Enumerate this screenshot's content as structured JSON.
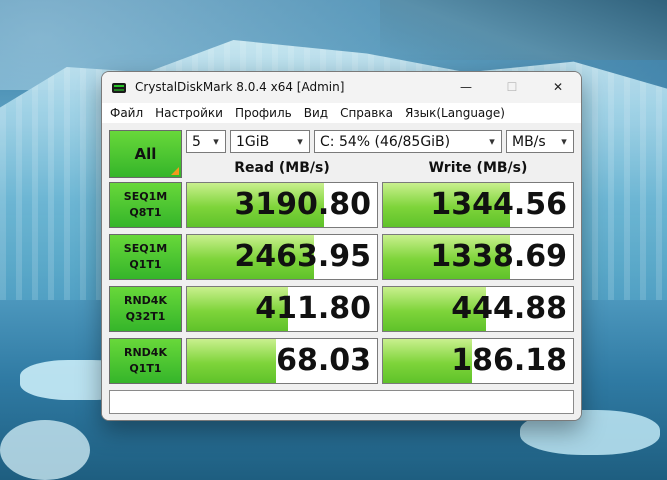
{
  "window": {
    "title": "CrystalDiskMark 8.0.4 x64 [Admin]",
    "controls": {
      "minimize": "—",
      "maximize": "☐",
      "close": "✕"
    }
  },
  "menu": [
    "Файл",
    "Настройки",
    "Профиль",
    "Вид",
    "Справка",
    "Язык(Language)"
  ],
  "controls": {
    "all_label": "All",
    "count": "5",
    "size": "1GiB",
    "drive": "C: 54% (46/85GiB)",
    "unit": "MB/s"
  },
  "columns": {
    "read": "Read (MB/s)",
    "write": "Write (MB/s)"
  },
  "tests": [
    {
      "line1": "SEQ1M",
      "line2": "Q8T1",
      "read": "3190.80",
      "write": "1344.56",
      "read_fill": 0.72,
      "write_fill": 0.67
    },
    {
      "line1": "SEQ1M",
      "line2": "Q1T1",
      "read": "2463.95",
      "write": "1338.69",
      "read_fill": 0.67,
      "write_fill": 0.67
    },
    {
      "line1": "RND4K",
      "line2": "Q32T1",
      "read": "411.80",
      "write": "444.88",
      "read_fill": 0.53,
      "write_fill": 0.54
    },
    {
      "line1": "RND4K",
      "line2": "Q1T1",
      "read": "68.03",
      "write": "186.18",
      "read_fill": 0.47,
      "write_fill": 0.47
    }
  ],
  "status_text": "",
  "colors": {
    "accent_green": "#4fc42e",
    "bar_green": "#7ed43a",
    "corner_orange": "#f29a1b"
  },
  "icons": {
    "app": "crystaldiskmark-icon",
    "dropdown": "chevron-down-icon"
  }
}
